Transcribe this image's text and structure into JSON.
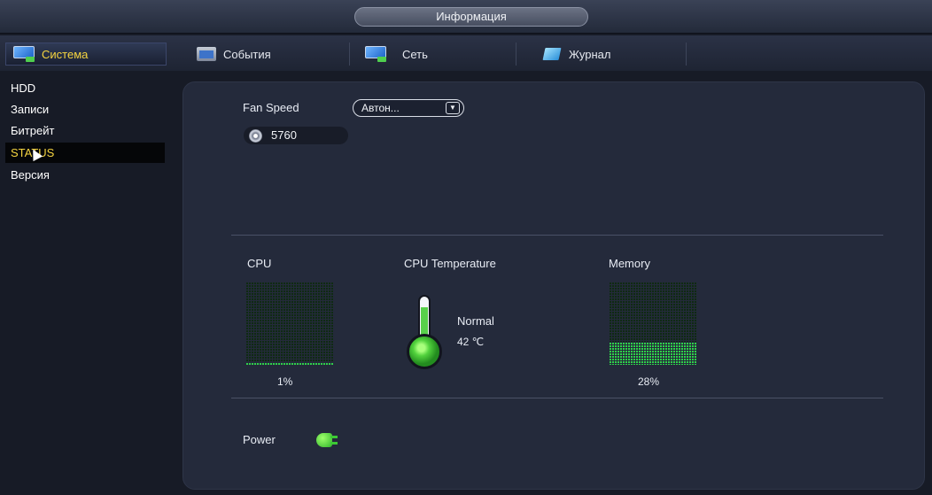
{
  "window": {
    "title": "Информация"
  },
  "tabs": [
    {
      "label": "Система",
      "icon": "monitor-icon",
      "active": true
    },
    {
      "label": "События",
      "icon": "events-icon",
      "active": false
    },
    {
      "label": "Сеть",
      "icon": "network-icon",
      "active": false
    },
    {
      "label": "Журнал",
      "icon": "log-icon",
      "active": false
    }
  ],
  "sidebar": {
    "items": [
      {
        "label": "HDD",
        "active": false
      },
      {
        "label": "Записи",
        "active": false
      },
      {
        "label": "Битрейт",
        "active": false
      },
      {
        "label": "STATUS",
        "active": true
      },
      {
        "label": "Версия",
        "active": false
      }
    ]
  },
  "status": {
    "fan_speed_label": "Fan Speed",
    "fan_mode_value": "Автон...",
    "fan_rpm": "5760",
    "cpu": {
      "label": "CPU",
      "percent_text": "1%",
      "value": 1
    },
    "cpu_temperature": {
      "label": "CPU Temperature",
      "state": "Normal",
      "value_text": "42 ℃"
    },
    "memory": {
      "label": "Memory",
      "percent_text": "28%",
      "value": 28
    },
    "power_label": "Power"
  },
  "colors": {
    "accent_active": "#f5d440",
    "meter_on": "#2fd14a",
    "meter_off": "#0f2a13",
    "panel_bg": "#242a3b"
  }
}
